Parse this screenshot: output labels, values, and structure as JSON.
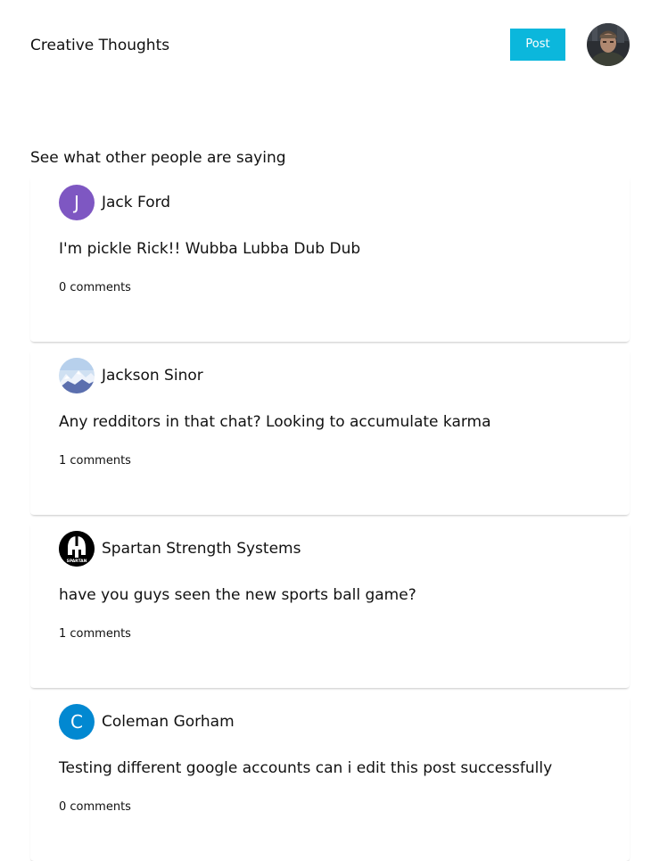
{
  "header": {
    "title": "Creative Thoughts",
    "post_label": "Post",
    "avatar_icon": "user-profile-photo",
    "accent_color": "#0bb7dc"
  },
  "feed": {
    "heading": "See what other people are saying",
    "posts": [
      {
        "author": "Jack Ford",
        "avatar_letter": "J",
        "avatar_color": "#7e57c2",
        "avatar_icon": "letter-avatar",
        "text": "I'm pickle Rick!! Wubba Lubba Dub Dub",
        "comments": "0 comments"
      },
      {
        "author": "Jackson Sinor",
        "avatar_icon": "mountain-landscape-avatar",
        "text": "Any redditors in that chat? Looking to accumulate karma",
        "comments": "1 comments"
      },
      {
        "author": "Spartan Strength Systems",
        "avatar_icon": "spartan-helmet-logo-avatar",
        "avatar_logo_text": "SPARTAN",
        "text": "have you guys seen the new sports ball game?",
        "comments": "1 comments"
      },
      {
        "author": "Coleman Gorham",
        "avatar_letter": "C",
        "avatar_color": "#0288d1",
        "avatar_icon": "letter-avatar",
        "text": "Testing different google accounts can i edit this post successfully",
        "comments": "0 comments"
      }
    ]
  }
}
